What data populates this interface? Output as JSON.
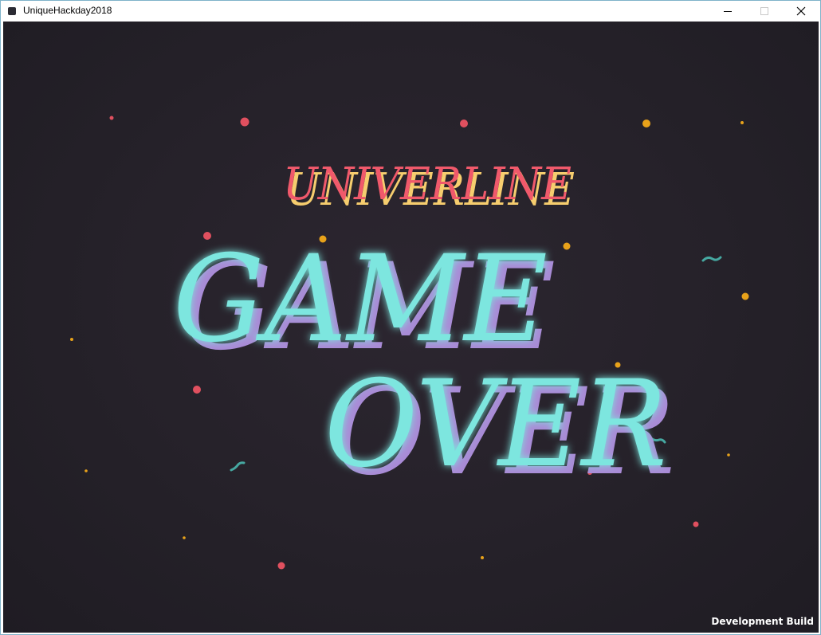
{
  "window": {
    "title": "UniqueHackday2018",
    "app_icon": "app-icon",
    "controls": {
      "minimize_icon": "minimize-icon",
      "maximize_icon": "maximize-icon",
      "close_icon": "close-icon"
    }
  },
  "game": {
    "logo_text": "UNIVERLINE",
    "headline_line1": "GAME",
    "headline_line2": "OVER",
    "footer_label": "Development Build",
    "colors": {
      "background": "#252129",
      "logo_primary": "#f0596b",
      "logo_shadow": "#f6cd6e",
      "headline_primary": "#7de6df",
      "headline_shadow": "#a98bd6",
      "particle_red": "#e0505f",
      "particle_gold": "#e8a21a",
      "particle_teal": "#46a8a1"
    }
  }
}
